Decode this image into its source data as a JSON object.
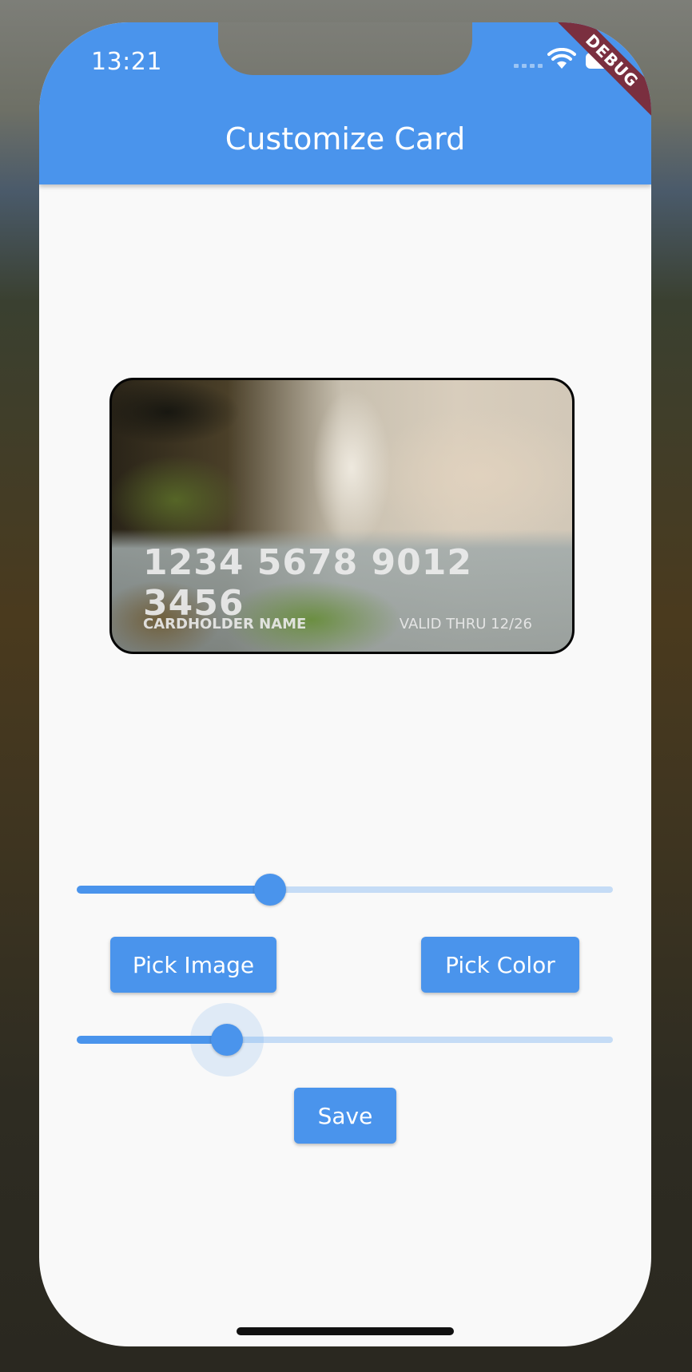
{
  "status_bar": {
    "time": "13:21"
  },
  "debug_banner": "DEBUG",
  "app_bar": {
    "title": "Customize Card"
  },
  "card": {
    "number": "1234 5678 9012 3456",
    "holder": "CARDHOLDER NAME",
    "valid_thru": "VALID THRU 12/26"
  },
  "slider_1": {
    "value": 0.36
  },
  "slider_2": {
    "value": 0.28,
    "active": true
  },
  "buttons": {
    "pick_image": "Pick Image",
    "pick_color": "Pick Color",
    "save": "Save"
  },
  "colors": {
    "accent": "#4a94ec",
    "debug": "#7a2f3f",
    "background": "#f9f9f9"
  }
}
